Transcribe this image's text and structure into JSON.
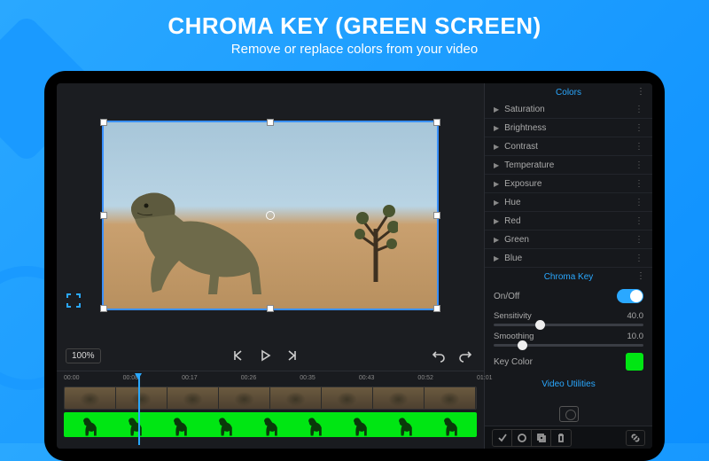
{
  "hero": {
    "title": "CHROMA KEY (GREEN SCREEN)",
    "subtitle": "Remove or replace colors from your video"
  },
  "transport": {
    "zoom_label": "100%"
  },
  "timeline": {
    "ruler_ticks": [
      "00:00",
      "00:08",
      "00:17",
      "00:26",
      "00:35",
      "00:43",
      "00:52",
      "01:01"
    ],
    "thumb_count": 8,
    "green_silhouette_count": 9
  },
  "panel": {
    "colors": {
      "title": "Colors",
      "props": [
        "Saturation",
        "Brightness",
        "Contrast",
        "Temperature",
        "Exposure",
        "Hue",
        "Red",
        "Green",
        "Blue"
      ]
    },
    "chroma": {
      "title": "Chroma Key",
      "onoff_label": "On/Off",
      "onoff": true,
      "sensitivity": {
        "label": "Sensitivity",
        "value": "40.0",
        "pos": 28
      },
      "smoothing": {
        "label": "Smoothing",
        "value": "10.0",
        "pos": 16
      },
      "keycolor_label": "Key Color",
      "keycolor": "#00e613"
    },
    "utilities_title": "Video Utilities"
  }
}
